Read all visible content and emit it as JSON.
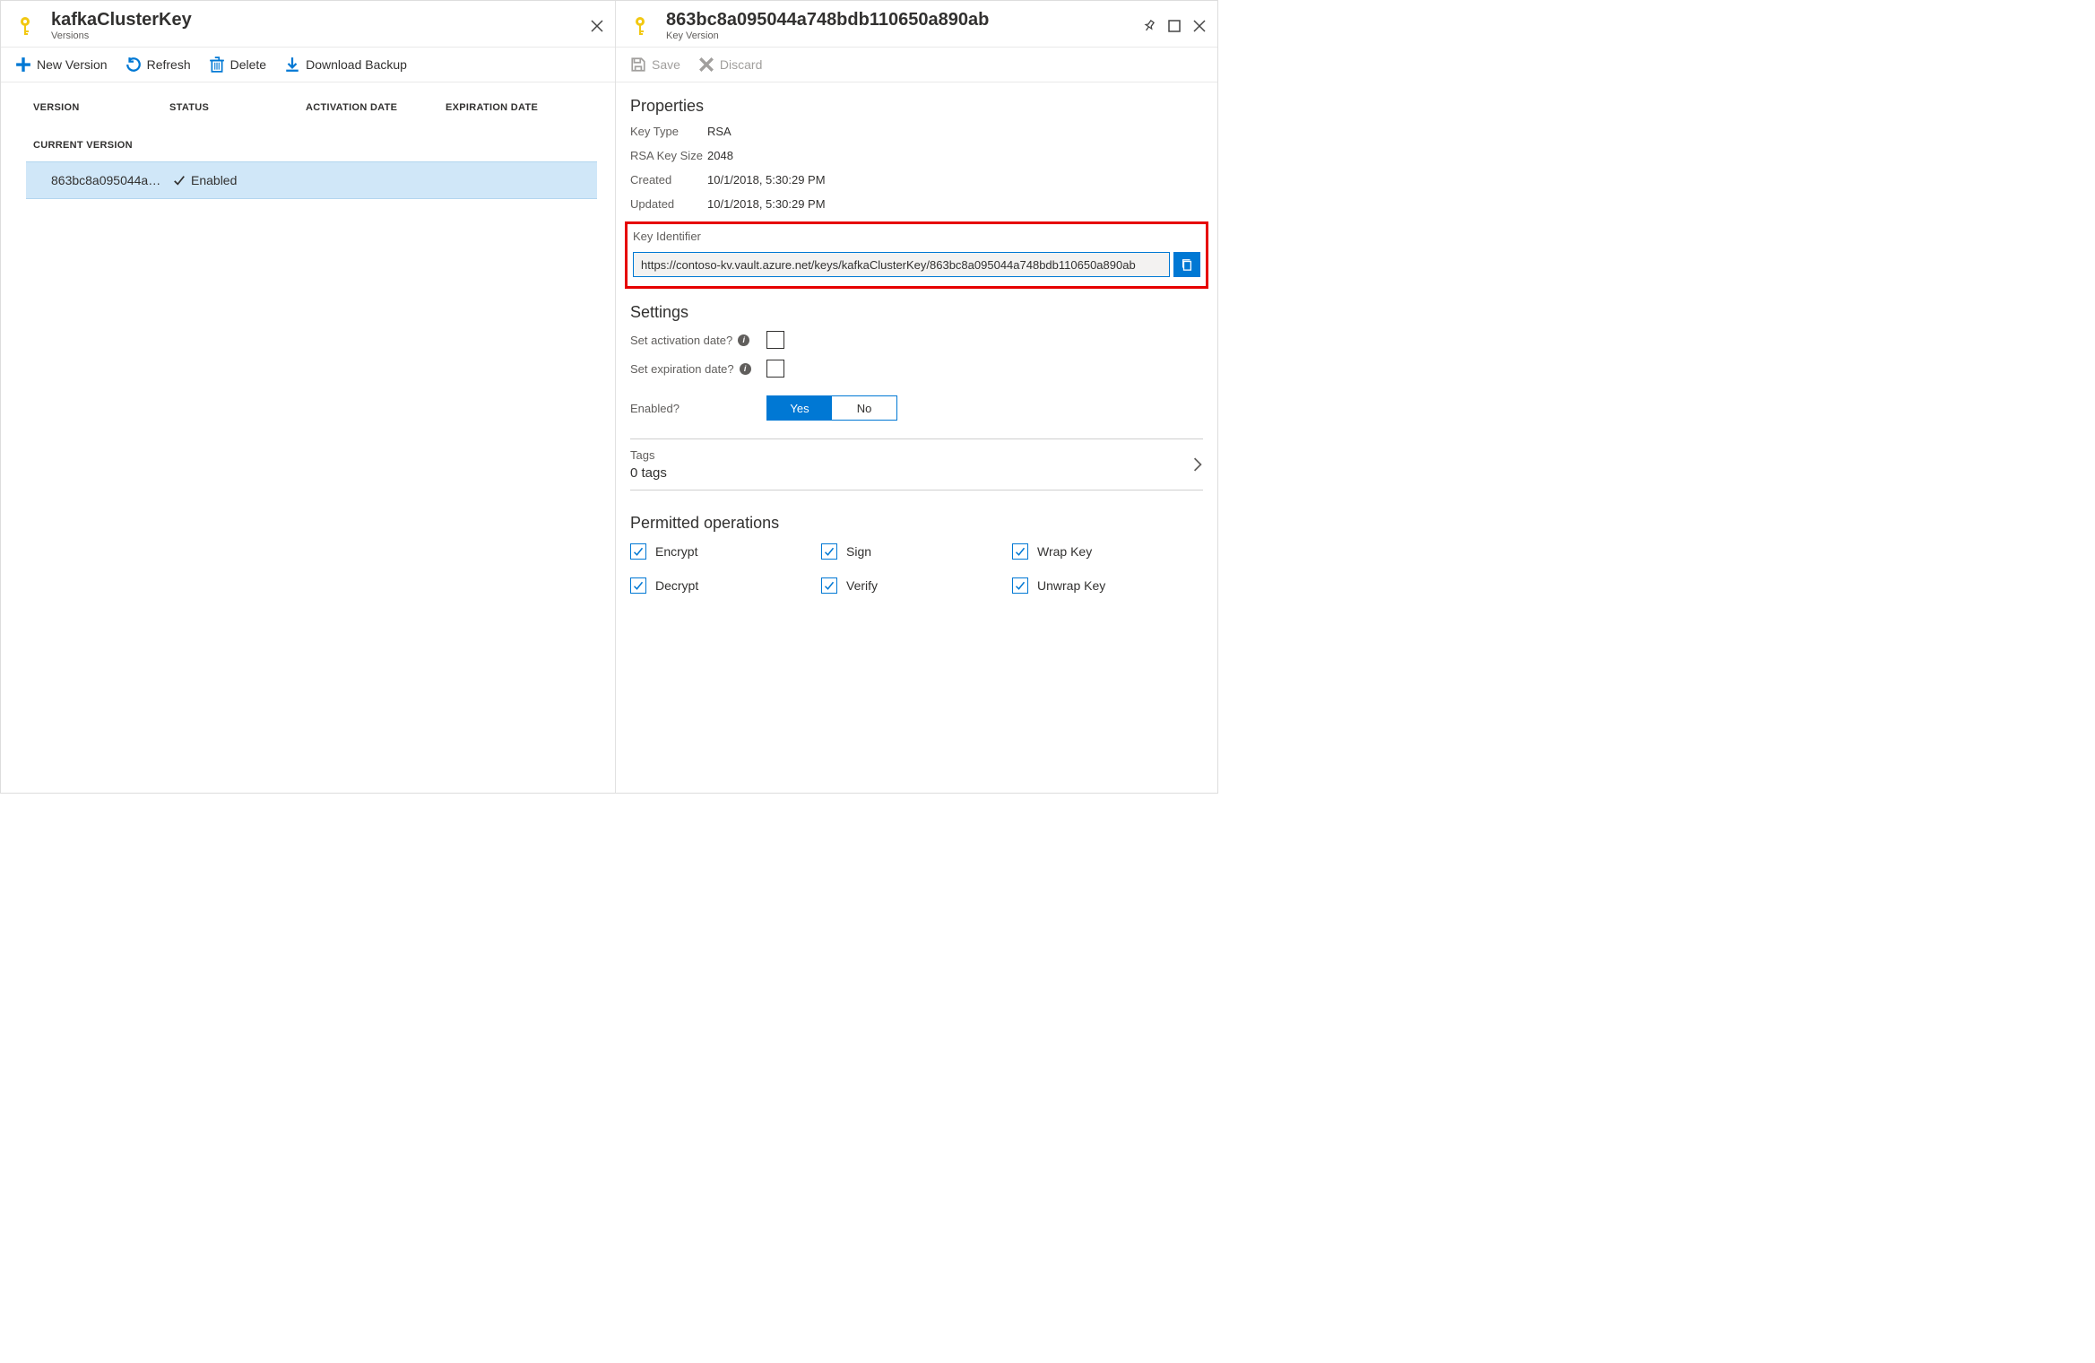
{
  "left": {
    "title": "kafkaClusterKey",
    "subtitle": "Versions",
    "cmd": {
      "new": "New Version",
      "refresh": "Refresh",
      "delete": "Delete",
      "download": "Download Backup"
    },
    "columns": {
      "version": "VERSION",
      "status": "STATUS",
      "activation": "ACTIVATION DATE",
      "expiration": "EXPIRATION DATE"
    },
    "group_header": "CURRENT VERSION",
    "row": {
      "version": "863bc8a095044a…",
      "status": "Enabled"
    }
  },
  "right": {
    "title": "863bc8a095044a748bdb110650a890ab",
    "subtitle": "Key Version",
    "cmd": {
      "save": "Save",
      "discard": "Discard"
    },
    "properties_header": "Properties",
    "props": {
      "key_type_label": "Key Type",
      "key_type_value": "RSA",
      "key_size_label": "RSA Key Size",
      "key_size_value": "2048",
      "created_label": "Created",
      "created_value": "10/1/2018, 5:30:29 PM",
      "updated_label": "Updated",
      "updated_value": "10/1/2018, 5:30:29 PM",
      "identifier_label": "Key Identifier",
      "identifier_value": "https://contoso-kv.vault.azure.net/keys/kafkaClusterKey/863bc8a095044a748bdb110650a890ab"
    },
    "settings_header": "Settings",
    "settings": {
      "activation_label": "Set activation date?",
      "expiration_label": "Set expiration date?",
      "enabled_label": "Enabled?",
      "yes": "Yes",
      "no": "No"
    },
    "tags": {
      "label": "Tags",
      "count": "0 tags"
    },
    "ops_header": "Permitted operations",
    "ops": {
      "encrypt": "Encrypt",
      "decrypt": "Decrypt",
      "sign": "Sign",
      "verify": "Verify",
      "wrap": "Wrap Key",
      "unwrap": "Unwrap Key"
    }
  }
}
